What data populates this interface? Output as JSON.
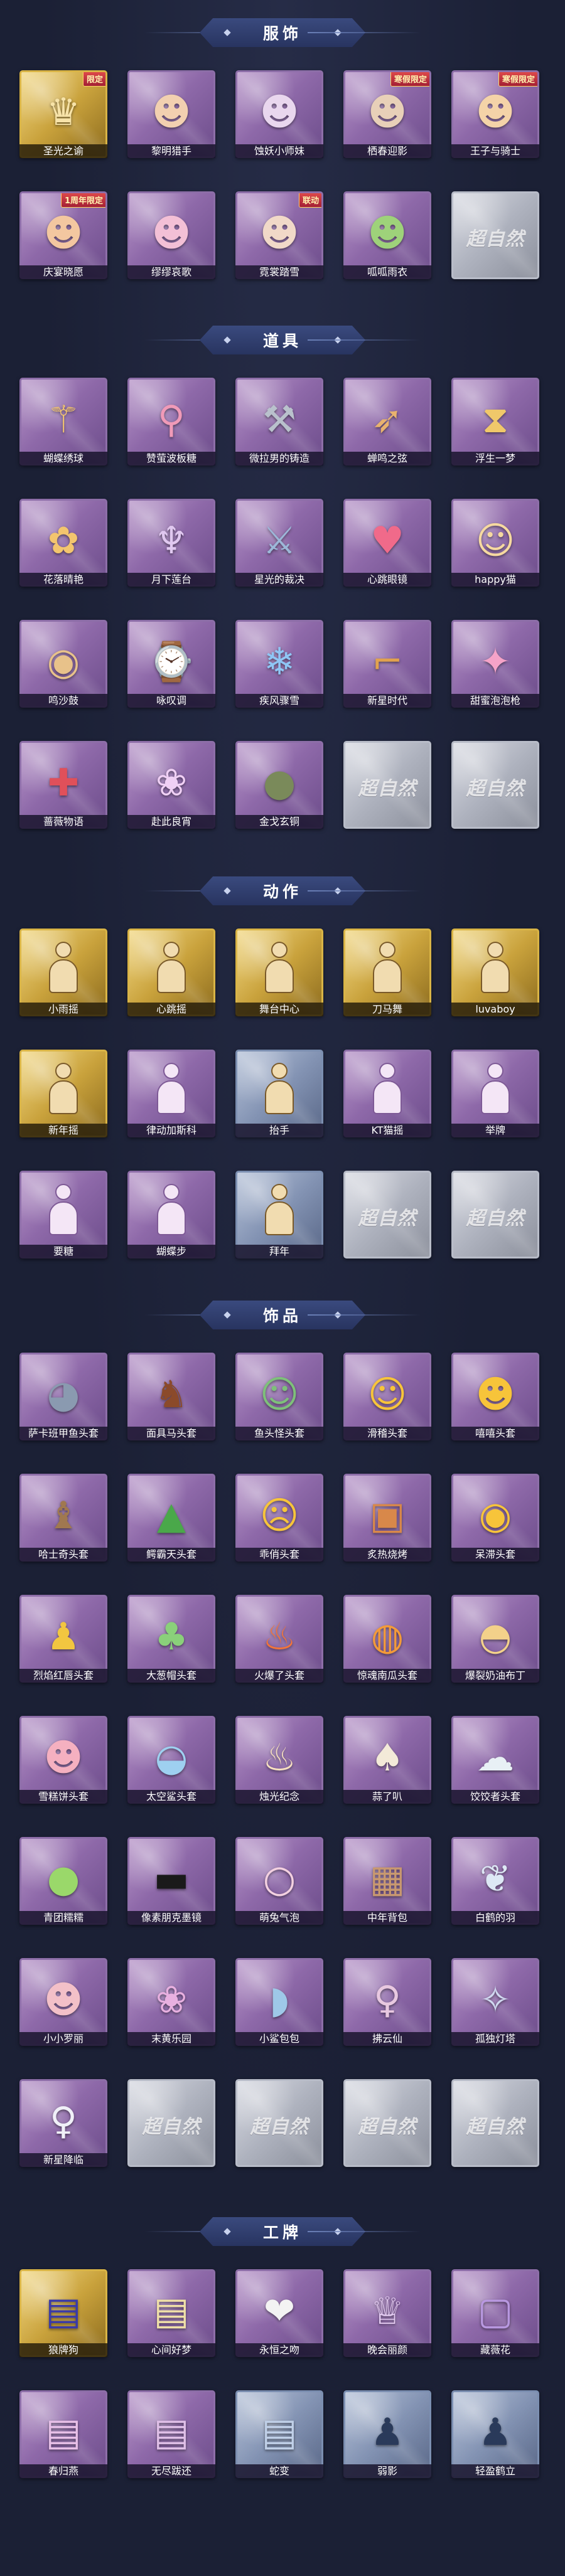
{
  "sections": [
    {
      "title": "服饰",
      "items": [
        {
          "label": "圣光之谕",
          "style": "gold",
          "badge": "限定",
          "icon": "costume-figure-icon",
          "glyph": "♛",
          "color": "#f7e3a8"
        },
        {
          "label": "黎明猎手",
          "style": "purple",
          "icon": "costume-figure-icon",
          "glyph": "☻",
          "color": "#f2d0b0"
        },
        {
          "label": "蚀妖小师妹",
          "style": "purple",
          "icon": "costume-figure-icon",
          "glyph": "☻",
          "color": "#e9d7ee"
        },
        {
          "label": "栖春迎影",
          "style": "purple",
          "badge": "寒假限定",
          "icon": "costume-figure-icon",
          "glyph": "☻",
          "color": "#e8d0b8"
        },
        {
          "label": "王子与骑士",
          "style": "purple",
          "badge": "寒假限定",
          "icon": "costume-figure-icon",
          "glyph": "☻",
          "color": "#f4d3a8"
        },
        {
          "label": "庆宴晓愿",
          "style": "purple",
          "badge": "1周年限定",
          "icon": "costume-figure-icon",
          "glyph": "☻",
          "color": "#f3c7a0"
        },
        {
          "label": "缪缪哀歌",
          "style": "purple",
          "icon": "costume-figure-icon",
          "glyph": "☻",
          "color": "#f3c0d6"
        },
        {
          "label": "霓裳踏雪",
          "style": "purple",
          "badge": "联动",
          "icon": "costume-figure-icon",
          "glyph": "☻",
          "color": "#f1d9c8"
        },
        {
          "label": "呱呱雨衣",
          "style": "purple",
          "icon": "costume-figure-icon",
          "glyph": "☻",
          "color": "#9ed27a"
        },
        {
          "label": "",
          "style": "empty",
          "placeholder": "超自然"
        }
      ]
    },
    {
      "title": "道具",
      "items": [
        {
          "label": "蝴蝶绣球",
          "style": "purple",
          "icon": "prop-wand-icon",
          "glyph": "⚚",
          "color": "#f3c56e"
        },
        {
          "label": "赞萤波板糖",
          "style": "purple",
          "icon": "prop-wand-icon",
          "glyph": "⚲",
          "color": "#f09ab8"
        },
        {
          "label": "微拉男的铸造",
          "style": "purple",
          "icon": "prop-wand-icon",
          "glyph": "⚒",
          "color": "#b9c1cc"
        },
        {
          "label": "蝉鸣之弦",
          "style": "purple",
          "icon": "prop-bow-icon",
          "glyph": "➶",
          "color": "#e8b26e"
        },
        {
          "label": "浮生一梦",
          "style": "purple",
          "icon": "prop-hourglass-icon",
          "glyph": "⧗",
          "color": "#f0c86a"
        },
        {
          "label": "花落晴艳",
          "style": "purple",
          "icon": "prop-staff-icon",
          "glyph": "✿",
          "color": "#f3c56e"
        },
        {
          "label": "月下莲台",
          "style": "purple",
          "icon": "prop-staff-icon",
          "glyph": "♆",
          "color": "#e0c8f0"
        },
        {
          "label": "星光的裁决",
          "style": "purple",
          "icon": "prop-gun-icon",
          "glyph": "⚔",
          "color": "#9cb7d8"
        },
        {
          "label": "心跳眼镜",
          "style": "purple",
          "icon": "prop-glasses-icon",
          "glyph": "♥",
          "color": "#f06a8a"
        },
        {
          "label": "happy猫",
          "style": "purple",
          "icon": "prop-cat-icon",
          "glyph": "☺",
          "color": "#f6d9a0"
        },
        {
          "label": "鸣沙鼓",
          "style": "purple",
          "icon": "prop-drum-icon",
          "glyph": "◉",
          "color": "#e8c28a"
        },
        {
          "label": "咏叹调",
          "style": "purple",
          "icon": "prop-clock-icon",
          "glyph": "⌚",
          "color": "#f3dfa8"
        },
        {
          "label": "疾风骤雪",
          "style": "purple",
          "icon": "prop-sign-icon",
          "glyph": "❄",
          "color": "#8fc6f5"
        },
        {
          "label": "新星时代",
          "style": "purple",
          "icon": "prop-pistol-icon",
          "glyph": "⌐",
          "color": "#e2a24e"
        },
        {
          "label": "甜蜜泡泡枪",
          "style": "purple",
          "icon": "prop-bubble-gun-icon",
          "glyph": "✦",
          "color": "#f5a3c8"
        },
        {
          "label": "蔷薇物语",
          "style": "purple",
          "icon": "prop-box-icon",
          "glyph": "✚",
          "color": "#e0505a"
        },
        {
          "label": "赴此良宵",
          "style": "purple",
          "icon": "prop-lantern-icon",
          "glyph": "❀",
          "color": "#f0d0f5"
        },
        {
          "label": "金戈玄铜",
          "style": "purple",
          "icon": "prop-grenade-icon",
          "glyph": "●",
          "color": "#7a8a5a"
        },
        {
          "label": "",
          "style": "empty",
          "placeholder": "超自然"
        },
        {
          "label": "",
          "style": "empty",
          "placeholder": "超自然"
        }
      ]
    },
    {
      "title": "动作",
      "items": [
        {
          "label": "小雨摇",
          "style": "gold",
          "icon": "action-pose-icon"
        },
        {
          "label": "心跳摇",
          "style": "gold",
          "icon": "action-pose-icon"
        },
        {
          "label": "舞台中心",
          "style": "gold",
          "icon": "action-pose-icon"
        },
        {
          "label": "刀马舞",
          "style": "gold",
          "icon": "action-pose-icon"
        },
        {
          "label": "luvaboy",
          "style": "gold",
          "icon": "action-pose-icon"
        },
        {
          "label": "新年摇",
          "style": "gold",
          "icon": "action-pose-icon"
        },
        {
          "label": "律动加斯科",
          "style": "purple-act",
          "icon": "action-pose-icon"
        },
        {
          "label": "抬手",
          "style": "blue",
          "icon": "action-pose-icon"
        },
        {
          "label": "KT猫摇",
          "style": "purple-act",
          "icon": "action-pose-icon"
        },
        {
          "label": "举牌",
          "style": "purple-act",
          "icon": "action-pose-icon"
        },
        {
          "label": "要糖",
          "style": "purple-act",
          "icon": "action-pose-icon"
        },
        {
          "label": "蝴蝶步",
          "style": "purple-act",
          "icon": "action-pose-icon"
        },
        {
          "label": "拜年",
          "style": "blue",
          "icon": "action-pose-icon"
        },
        {
          "label": "",
          "style": "empty",
          "placeholder": "超自然"
        },
        {
          "label": "",
          "style": "empty",
          "placeholder": "超自然"
        }
      ]
    },
    {
      "title": "饰品",
      "items": [
        {
          "label": "萨卡班甲鱼头套",
          "style": "purple",
          "icon": "mask-fish-icon",
          "glyph": "◕",
          "color": "#8a9ab0"
        },
        {
          "label": "面具马头套",
          "style": "purple",
          "icon": "mask-horse-icon",
          "glyph": "♞",
          "color": "#8b4a2a"
        },
        {
          "label": "鱼头怪头套",
          "style": "purple",
          "icon": "mask-fishman-icon",
          "glyph": "☺",
          "color": "#7ec07a"
        },
        {
          "label": "滑稽头套",
          "style": "purple",
          "icon": "mask-emoji-icon",
          "glyph": "☺",
          "color": "#f7c43a"
        },
        {
          "label": "嘻嘻头套",
          "style": "purple",
          "icon": "mask-emoji-icon",
          "glyph": "☻",
          "color": "#f7c43a"
        },
        {
          "label": "哈士奇头套",
          "style": "purple",
          "icon": "mask-dog-icon",
          "glyph": "♝",
          "color": "#a07850"
        },
        {
          "label": "鳄霸天头套",
          "style": "purple",
          "icon": "mask-croc-icon",
          "glyph": "▲",
          "color": "#4aa84a"
        },
        {
          "label": "乖俏头套",
          "style": "purple",
          "icon": "mask-emoji-icon",
          "glyph": "☹",
          "color": "#f7c43a"
        },
        {
          "label": "炙热烧烤",
          "style": "purple",
          "icon": "mask-grill-icon",
          "glyph": "▣",
          "color": "#d8884a"
        },
        {
          "label": "呆滞头套",
          "style": "purple",
          "icon": "mask-emoji-icon",
          "glyph": "◉",
          "color": "#f7c43a"
        },
        {
          "label": "烈焰红唇头套",
          "style": "purple",
          "icon": "mask-duck-icon",
          "glyph": "♟",
          "color": "#f2c640"
        },
        {
          "label": "大葱帽头套",
          "style": "purple",
          "icon": "mask-cabbage-icon",
          "glyph": "♣",
          "color": "#8ad07a"
        },
        {
          "label": "火爆了头套",
          "style": "purple",
          "icon": "mask-fire-icon",
          "glyph": "♨",
          "color": "#f2743a"
        },
        {
          "label": "惊魂南瓜头套",
          "style": "purple",
          "icon": "mask-pumpkin-icon",
          "glyph": "◍",
          "color": "#f29a3a"
        },
        {
          "label": "爆裂奶油布丁",
          "style": "purple",
          "icon": "mask-pudding-icon",
          "glyph": "◓",
          "color": "#f3d18a"
        },
        {
          "label": "雪糕饼头套",
          "style": "purple",
          "icon": "mask-mochi-icon",
          "glyph": "☻",
          "color": "#f5b0c0"
        },
        {
          "label": "太空鲨头套",
          "style": "purple",
          "icon": "mask-shark-icon",
          "glyph": "◒",
          "color": "#9ed0f0"
        },
        {
          "label": "烛光纪念",
          "style": "purple",
          "icon": "mask-candle-icon",
          "glyph": "♨",
          "color": "#f7e0c0"
        },
        {
          "label": "蒜了叭",
          "style": "purple",
          "icon": "mask-garlic-icon",
          "glyph": "♠",
          "color": "#f3ead8"
        },
        {
          "label": "饺饺者头套",
          "style": "purple",
          "icon": "mask-dumpling-icon",
          "glyph": "☁",
          "color": "#e8f0f5"
        },
        {
          "label": "青团糯糯",
          "style": "purple",
          "icon": "mask-qingtuan-icon",
          "glyph": "●",
          "color": "#9ad86a"
        },
        {
          "label": "像素朋克墨镜",
          "style": "purple",
          "icon": "pixel-glasses-icon",
          "glyph": "▬",
          "color": "#1a1a1a"
        },
        {
          "label": "萌兔气泡",
          "style": "purple",
          "icon": "bubble-bunny-icon",
          "glyph": "○",
          "color": "#f3d0e0"
        },
        {
          "label": "中年背包",
          "style": "purple",
          "icon": "backpack-icon",
          "glyph": "▦",
          "color": "#c89870"
        },
        {
          "label": "白鹤的羽",
          "style": "purple",
          "icon": "feather-icon",
          "glyph": "❦",
          "color": "#dde8f5"
        },
        {
          "label": "小小罗丽",
          "style": "purple",
          "icon": "doll-icon",
          "glyph": "☻",
          "color": "#f3c0c8"
        },
        {
          "label": "末黄乐园",
          "style": "purple",
          "icon": "doll-icon",
          "glyph": "❀",
          "color": "#e8b0e0"
        },
        {
          "label": "小鲨包包",
          "style": "purple",
          "icon": "shark-bag-icon",
          "glyph": "◗",
          "color": "#9ec8e8"
        },
        {
          "label": "拂云仙",
          "style": "purple",
          "icon": "pendant-icon",
          "glyph": "♀",
          "color": "#e8c8e0"
        },
        {
          "label": "孤独灯塔",
          "style": "purple",
          "icon": "pendant-icon",
          "glyph": "✧",
          "color": "#d0d8f0"
        },
        {
          "label": "新星降临",
          "style": "purple",
          "icon": "pendant-icon",
          "glyph": "♀",
          "color": "#f0f0f8"
        },
        {
          "label": "",
          "style": "empty",
          "placeholder": "超自然"
        },
        {
          "label": "",
          "style": "empty",
          "placeholder": "超自然"
        },
        {
          "label": "",
          "style": "empty",
          "placeholder": "超自然"
        },
        {
          "label": "",
          "style": "empty",
          "placeholder": "超自然"
        }
      ]
    },
    {
      "title": "工牌",
      "items": [
        {
          "label": "狼牌狗",
          "style": "gold",
          "icon": "badge-card-icon",
          "glyph": "▤",
          "color": "#3a3aa8"
        },
        {
          "label": "心间好梦",
          "style": "purple",
          "icon": "badge-card-icon",
          "glyph": "▤",
          "color": "#f0e0a8"
        },
        {
          "label": "永恒之吻",
          "style": "purple",
          "icon": "badge-card-icon",
          "glyph": "❤",
          "color": "#f3f3f3"
        },
        {
          "label": "晚会丽颜",
          "style": "purple",
          "icon": "badge-card-icon",
          "glyph": "♕",
          "color": "#e8d0f5"
        },
        {
          "label": "藏薇花",
          "style": "purple",
          "icon": "badge-card-icon",
          "glyph": "▢",
          "color": "#b898e0"
        },
        {
          "label": "春归燕",
          "style": "purple",
          "icon": "badge-card-icon",
          "glyph": "▤",
          "color": "#e8c0e8"
        },
        {
          "label": "无尽跋还",
          "style": "purple",
          "icon": "badge-card-icon",
          "glyph": "▤",
          "color": "#e0c0e8"
        },
        {
          "label": "蛇变",
          "style": "blue",
          "icon": "badge-card-icon",
          "glyph": "▤",
          "color": "#c0d0e8"
        },
        {
          "label": "弱影",
          "style": "blue",
          "icon": "badge-card-icon",
          "glyph": "♟",
          "color": "#2a3a5a"
        },
        {
          "label": "轻盈鹤立",
          "style": "blue",
          "icon": "badge-card-icon",
          "glyph": "♟",
          "color": "#2a3a5a"
        }
      ]
    }
  ]
}
